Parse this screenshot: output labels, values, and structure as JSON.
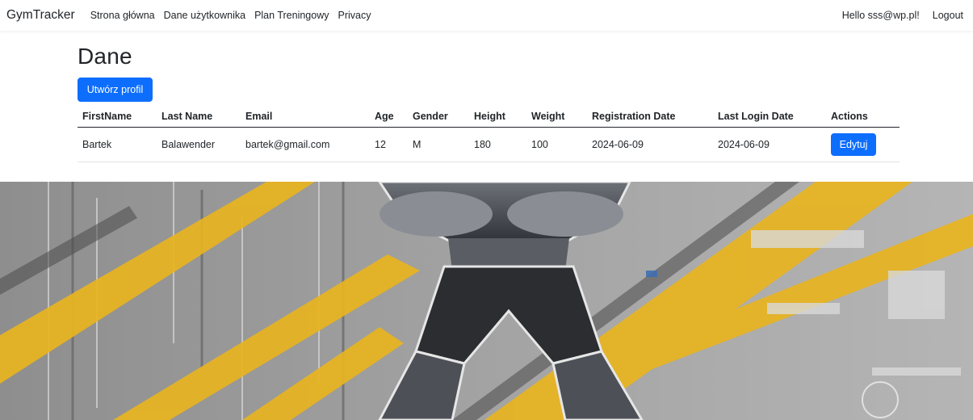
{
  "navbar": {
    "brand": "GymTracker",
    "links": [
      "Strona główna",
      "Dane użytkownika",
      "Plan Treningowy",
      "Privacy"
    ],
    "greeting": "Hello sss@wp.pl!",
    "logout": "Logout"
  },
  "main": {
    "title": "Dane",
    "create_button": "Utwórz profil",
    "table": {
      "headers": [
        "FirstName",
        "Last Name",
        "Email",
        "Age",
        "Gender",
        "Height",
        "Weight",
        "Registration Date",
        "Last Login Date",
        "Actions"
      ],
      "rows": [
        {
          "first_name": "Bartek",
          "last_name": "Balawender",
          "email": "bartek@gmail.com",
          "age": "12",
          "gender": "M",
          "height": "180",
          "weight": "100",
          "registration_date": "2024-06-09",
          "last_login_date": "2024-06-09",
          "action": "Edytuj"
        }
      ]
    }
  },
  "hero": {
    "subject": "muscular-bodybuilder-illustration",
    "colors": {
      "background": "#9a9a9a",
      "accent": "#e8b420",
      "figure": "#3b3f45"
    }
  },
  "colors": {
    "primary": "#0d6efd",
    "text": "#212529"
  }
}
